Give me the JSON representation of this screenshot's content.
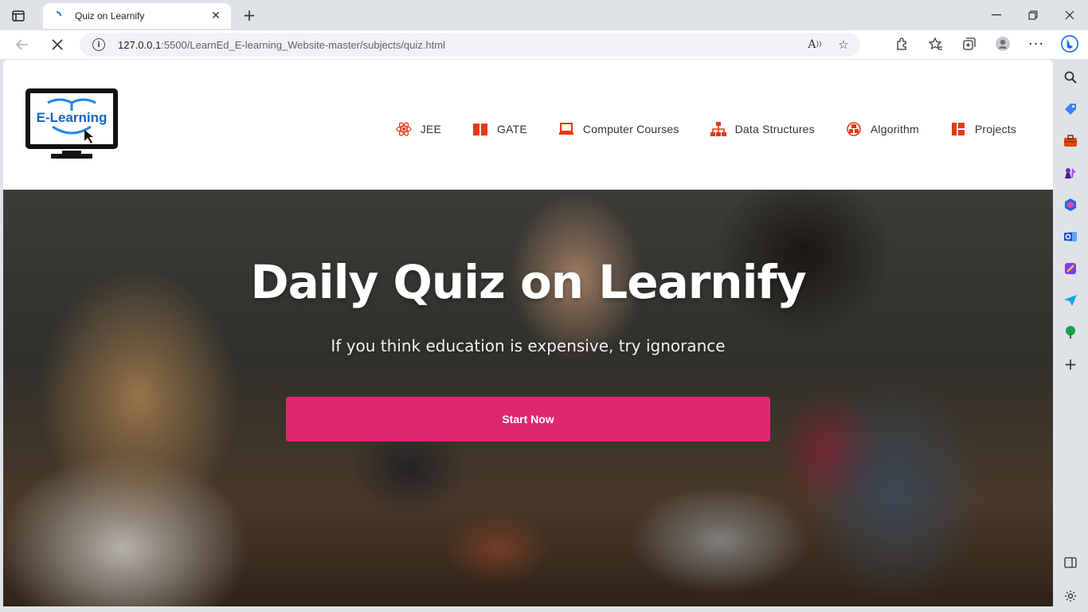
{
  "browser": {
    "tab_title": "Quiz on Learnify",
    "url_host": "127.0.0.1",
    "url_rest": ":5500/LearnEd_E-learning_Website-master/subjects/quiz.html"
  },
  "site": {
    "logo_text": "E-Learning",
    "nav": [
      {
        "label": "JEE",
        "icon": "atom-icon"
      },
      {
        "label": "GATE",
        "icon": "book-icon"
      },
      {
        "label": "Computer Courses",
        "icon": "laptop-icon"
      },
      {
        "label": "Data Structures",
        "icon": "sitemap-icon"
      },
      {
        "label": "Algorithm",
        "icon": "cubes-icon"
      },
      {
        "label": "Projects",
        "icon": "dashboard-icon"
      }
    ]
  },
  "hero": {
    "title": "Daily Quiz on Learnify",
    "subtitle": "If you think education is expensive, try ignorance",
    "cta": "Start Now"
  },
  "colors": {
    "accent": "#df2771",
    "nav_icon": "#e8380d"
  }
}
